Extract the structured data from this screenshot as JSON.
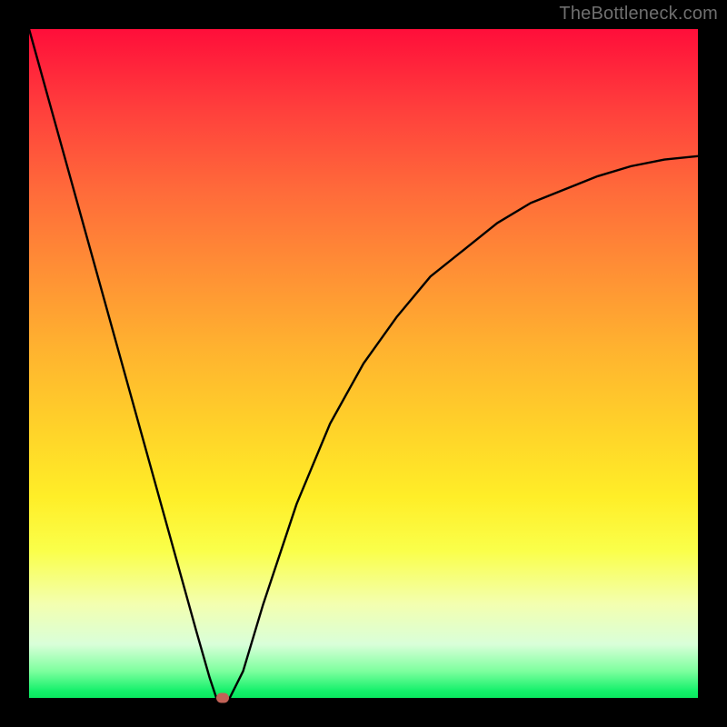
{
  "watermark": "TheBottleneck.com",
  "chart_data": {
    "type": "line",
    "title": "",
    "xlabel": "",
    "ylabel": "",
    "xlim": [
      0,
      100
    ],
    "ylim": [
      0,
      100
    ],
    "grid": false,
    "legend": false,
    "series": [
      {
        "name": "curve",
        "x": [
          0,
          5,
          10,
          15,
          20,
          25,
          27,
          28,
          29,
          30,
          32,
          35,
          40,
          45,
          50,
          55,
          60,
          65,
          70,
          75,
          80,
          85,
          90,
          95,
          100
        ],
        "y": [
          100,
          82,
          64,
          46,
          28,
          10,
          3,
          0,
          0,
          0,
          4,
          14,
          29,
          41,
          50,
          57,
          63,
          67,
          71,
          74,
          76,
          78,
          79.5,
          80.5,
          81
        ]
      }
    ],
    "marker": {
      "x": 29,
      "y": 0
    },
    "gradient_colors": {
      "top": "#ff0e3a",
      "bottom": "#0ae85f"
    }
  }
}
